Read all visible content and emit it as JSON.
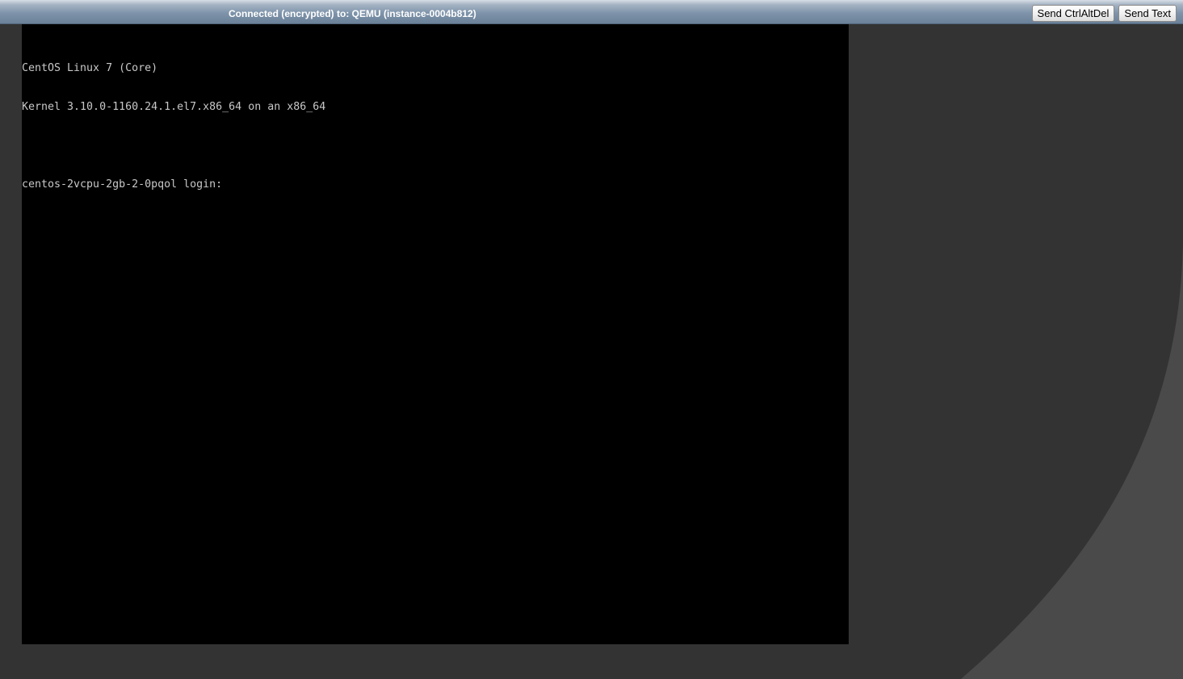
{
  "status_bar": {
    "connection_text": "Connected (encrypted) to: QEMU (instance-0004b812)",
    "buttons": {
      "ctrl_alt_del": "Send CtrlAltDel",
      "send_text": "Send Text"
    }
  },
  "console": {
    "lines": [
      "CentOS Linux 7 (Core)",
      "Kernel 3.10.0-1160.24.1.el7.x86_64 on an x86_64",
      "",
      "centos-2vcpu-2gb-2-0pqol login: "
    ]
  },
  "colors": {
    "background": "#333333",
    "swoosh": "#4a4a4a",
    "console_bg": "#000000",
    "console_text": "#c8c8c8"
  }
}
